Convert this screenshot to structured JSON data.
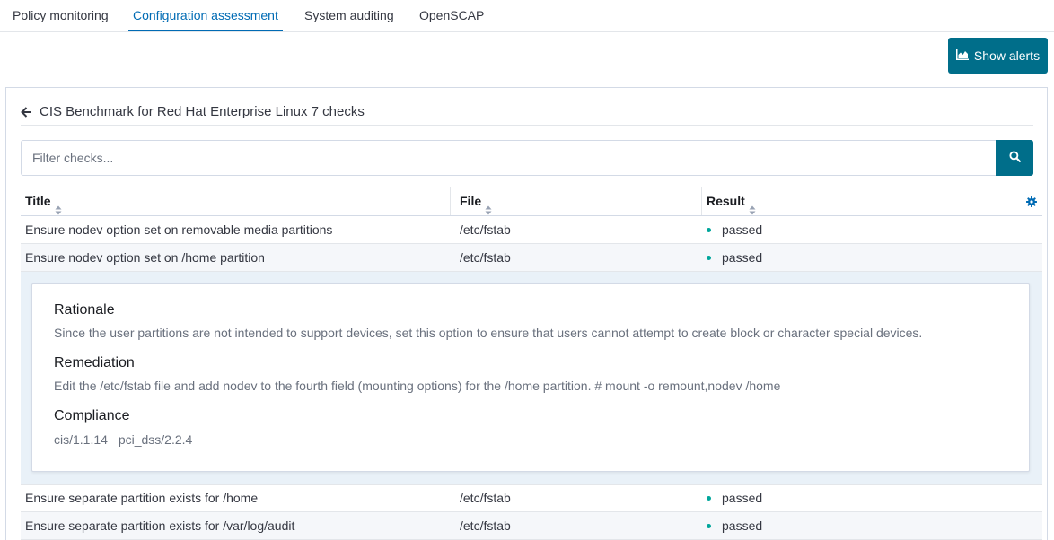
{
  "tabs": [
    {
      "label": "Policy monitoring",
      "active": false
    },
    {
      "label": "Configuration assessment",
      "active": true
    },
    {
      "label": "System auditing",
      "active": false
    },
    {
      "label": "OpenSCAP",
      "active": false
    }
  ],
  "toolbar": {
    "show_alerts_label": "Show alerts",
    "show_alerts_icon": "area-chart-icon"
  },
  "panel": {
    "back_icon": "arrow-left-icon",
    "title": "CIS Benchmark for Red Hat Enterprise Linux 7 checks"
  },
  "search": {
    "placeholder": "Filter checks...",
    "value": "",
    "button_icon": "search-icon"
  },
  "table": {
    "columns": [
      "Title",
      "File",
      "Result"
    ],
    "settings_icon": "gear-icon",
    "rows": [
      {
        "title": "Ensure nodev option set on removable media partitions",
        "file": "/etc/fstab",
        "result": "passed"
      },
      {
        "title": "Ensure nodev option set on /home partition",
        "file": "/etc/fstab",
        "result": "passed",
        "expanded": true
      },
      {
        "title": "Ensure separate partition exists for /home",
        "file": "/etc/fstab",
        "result": "passed"
      },
      {
        "title": "Ensure separate partition exists for /var/log/audit",
        "file": "/etc/fstab",
        "result": "passed"
      }
    ],
    "result_color": "#00a69b"
  },
  "details": {
    "rationale_heading": "Rationale",
    "rationale_text": "Since the user partitions are not intended to support devices, set this option to ensure that users cannot attempt to create block or character special devices.",
    "remediation_heading": "Remediation",
    "remediation_text": "Edit the /etc/fstab file and add nodev to the fourth field (mounting options) for the /home partition. # mount -o remount,nodev /home",
    "compliance_heading": "Compliance",
    "compliance_items": [
      "cis/1.1.14",
      "pci_dss/2.2.4"
    ]
  },
  "colors": {
    "accent": "#006bb4",
    "button": "#006e8a",
    "passed": "#00a69b"
  }
}
